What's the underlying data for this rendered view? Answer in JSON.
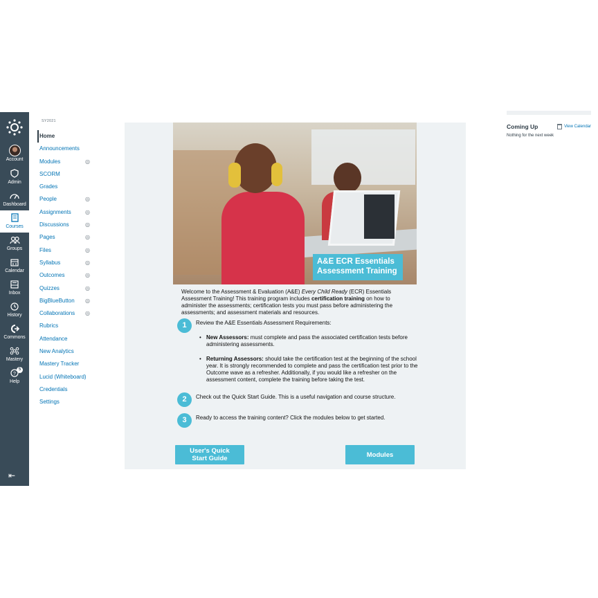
{
  "global_nav": {
    "items": [
      {
        "label": "Account",
        "icon": "avatar"
      },
      {
        "label": "Admin",
        "icon": "shield-icon"
      },
      {
        "label": "Dashboard",
        "icon": "dashboard-icon"
      },
      {
        "label": "Courses",
        "icon": "book-icon",
        "active": true
      },
      {
        "label": "Groups",
        "icon": "groups-icon"
      },
      {
        "label": "Calendar",
        "icon": "calendar-icon"
      },
      {
        "label": "Inbox",
        "icon": "inbox-icon"
      },
      {
        "label": "History",
        "icon": "clock-icon"
      },
      {
        "label": "Commons",
        "icon": "commons-icon"
      },
      {
        "label": "Mastery",
        "icon": "mastery-icon"
      },
      {
        "label": "Help",
        "icon": "help-icon",
        "badge": "5"
      }
    ],
    "collapse_icon": "collapse-icon"
  },
  "course_nav": {
    "term": "SY2021",
    "items": [
      {
        "label": "Home",
        "active": true
      },
      {
        "label": "Announcements"
      },
      {
        "label": "Modules",
        "hidden": true
      },
      {
        "label": "SCORM"
      },
      {
        "label": "Grades"
      },
      {
        "label": "People",
        "hidden": true
      },
      {
        "label": "Assignments",
        "hidden": true
      },
      {
        "label": "Discussions",
        "hidden": true
      },
      {
        "label": "Pages",
        "hidden": true
      },
      {
        "label": "Files",
        "hidden": true
      },
      {
        "label": "Syllabus",
        "hidden": true
      },
      {
        "label": "Outcomes",
        "hidden": true
      },
      {
        "label": "Quizzes",
        "hidden": true
      },
      {
        "label": "BigBlueButton",
        "hidden": true
      },
      {
        "label": "Collaborations",
        "hidden": true
      },
      {
        "label": "Rubrics"
      },
      {
        "label": "Attendance"
      },
      {
        "label": "New Analytics"
      },
      {
        "label": "Mastery Tracker"
      },
      {
        "label": "Lucid (Whiteboard)"
      },
      {
        "label": "Credentials"
      },
      {
        "label": "Settings"
      }
    ]
  },
  "main": {
    "hero_title": "A&E ECR Essentials Assessment Training",
    "intro_1": "Welcome to the Assessment & Evaluation (A&E) ",
    "intro_em": "Every Child Ready",
    "intro_2": " (ECR) Essentials Assessment Training! This training program includes ",
    "intro_strong": "certification training",
    "intro_3": " on how to administer the assessments; certification tests you must pass before administering the assessments; and assessment materials and resources.",
    "steps": [
      {
        "number": "1",
        "text": "Review the A&E Essentials Assessment Requirements:"
      },
      {
        "number": "2",
        "text": "Check out the Quick Start Guide. This is a useful navigation and course structure."
      },
      {
        "number": "3",
        "text": "Ready to access the training content? Click the modules below to get started."
      }
    ],
    "bullets": [
      {
        "label": "New Assessors:",
        "text": " must complete and pass the associated certification tests before administering assessments."
      },
      {
        "label": "Returning Assessors:",
        "text": " should take the certification test at the beginning of the school year. It is strongly recommended to complete and pass the certification test prior to the Outcome wave as a refresher. Additionally, if you would like a refresher on the assessment content, complete the training before taking the test."
      }
    ],
    "buttons": {
      "quick_start_line1": "User's Quick",
      "quick_start_line2": "Start Guide",
      "modules": "Modules"
    }
  },
  "sidebar": {
    "coming_up": "Coming Up",
    "view_calendar": "View Calendar",
    "empty": "Nothing for the next week"
  },
  "colors": {
    "nav_bg": "#394b58",
    "accent": "#4bbcd6",
    "link": "#0374b5",
    "content_bg": "#eef2f4"
  }
}
